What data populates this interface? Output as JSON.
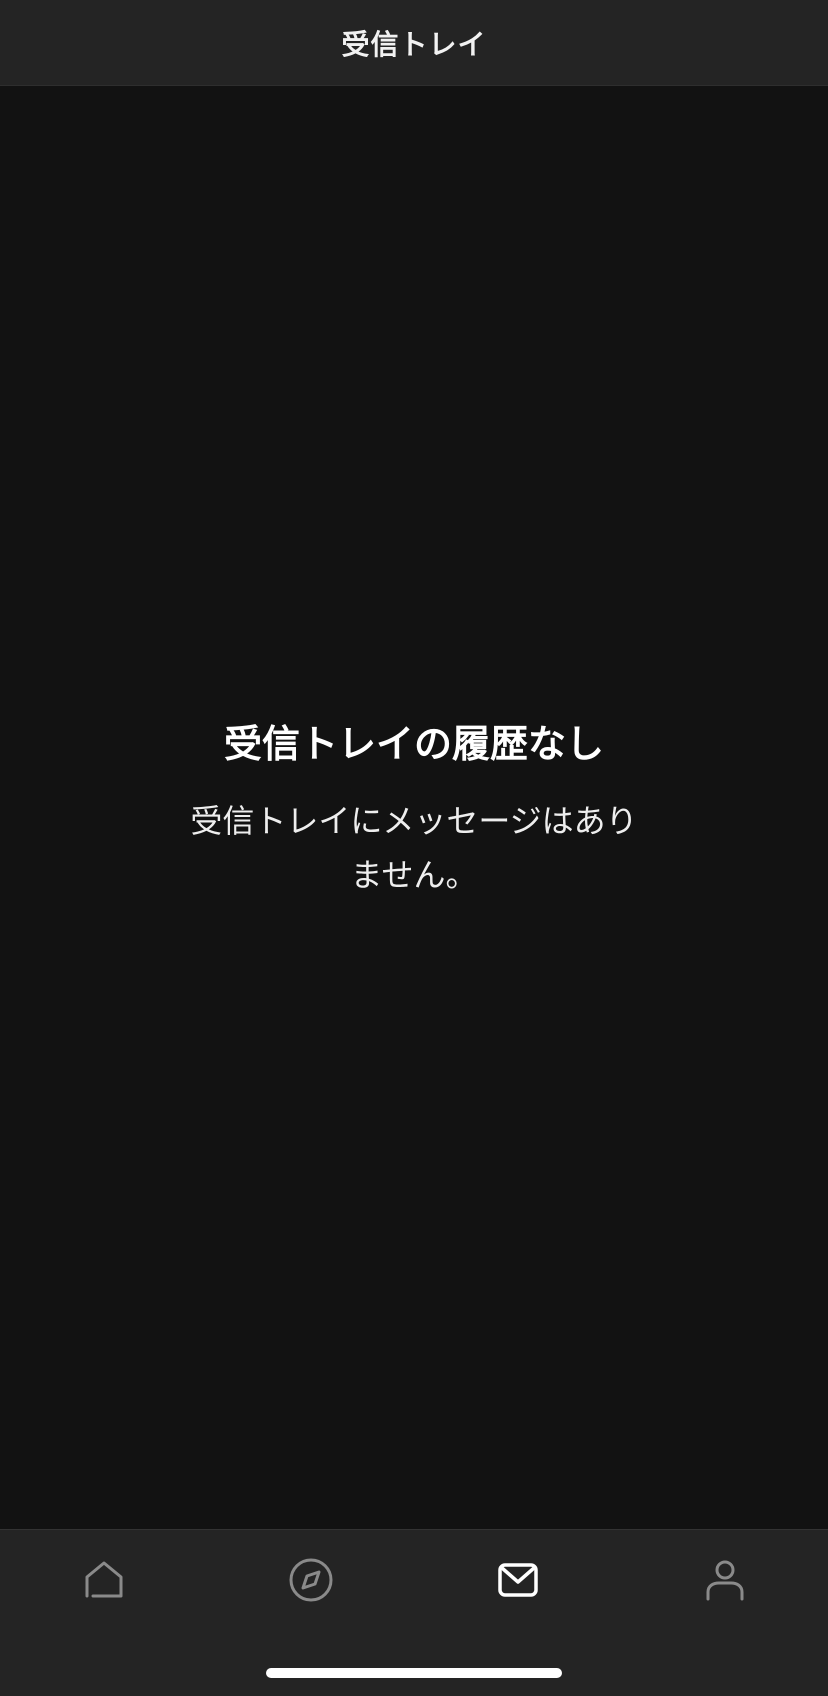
{
  "header": {
    "title": "受信トレイ"
  },
  "empty_state": {
    "title": "受信トレイの履歴なし",
    "message": "受信トレイにメッセージはありません。"
  },
  "tabbar": {
    "tabs": [
      {
        "name": "home",
        "icon": "home-icon",
        "active": false
      },
      {
        "name": "explore",
        "icon": "compass-icon",
        "active": false
      },
      {
        "name": "inbox",
        "icon": "mail-icon",
        "active": true
      },
      {
        "name": "profile",
        "icon": "person-icon",
        "active": false
      }
    ],
    "active_color": "#ffffff",
    "inactive_color": "#8a8a8a"
  },
  "colors": {
    "background": "#121212",
    "bars": "#242424"
  }
}
